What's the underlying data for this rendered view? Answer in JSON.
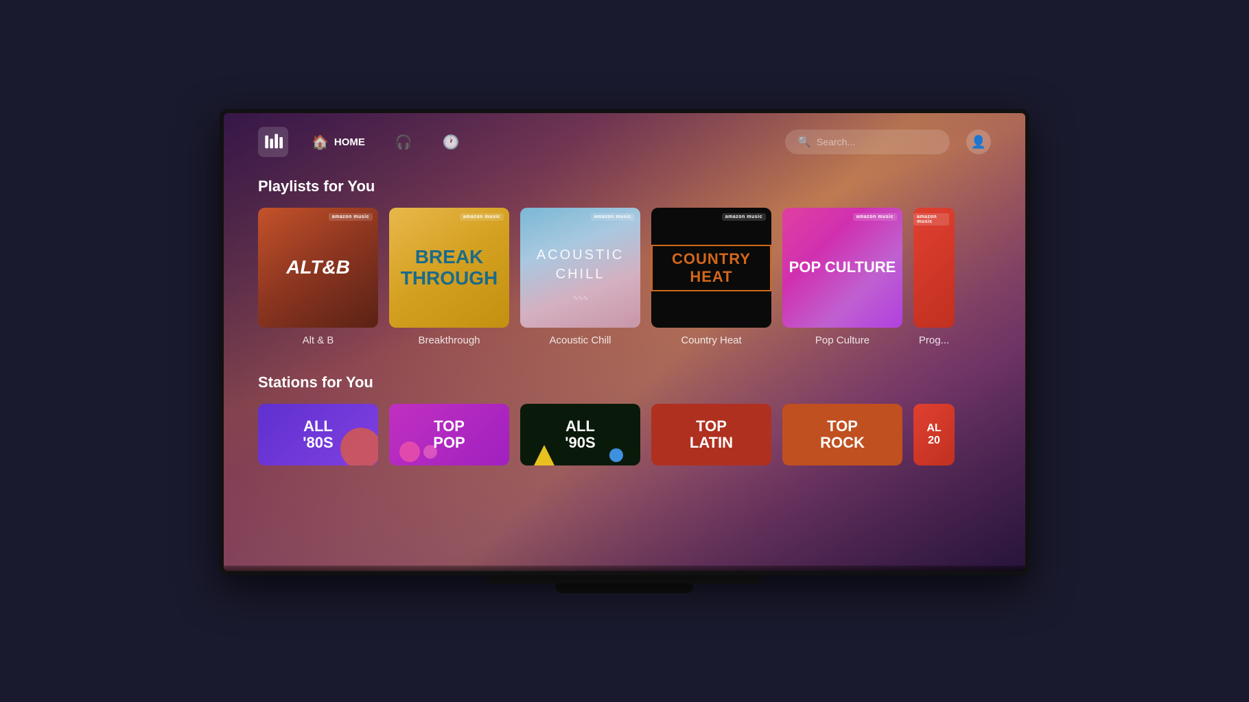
{
  "app": {
    "title": "Amazon Music"
  },
  "nav": {
    "logo_aria": "Amazon Music Logo",
    "items": [
      {
        "id": "home",
        "label": "HOME",
        "icon": "🏠",
        "active": true
      },
      {
        "id": "headphones",
        "label": "",
        "icon": "🎧",
        "active": false
      },
      {
        "id": "history",
        "label": "",
        "icon": "🕐",
        "active": false
      }
    ],
    "search_placeholder": "Search...",
    "user_icon": "👤"
  },
  "playlists_section": {
    "title": "Playlists for You",
    "cards": [
      {
        "id": "alt-b",
        "label": "Alt & B",
        "style": "altb",
        "badge": "amazon music"
      },
      {
        "id": "breakthrough",
        "label": "Breakthrough",
        "style": "breakthrough",
        "badge": "amazon music"
      },
      {
        "id": "acoustic-chill",
        "label": "Acoustic Chill",
        "style": "acoustic",
        "badge": "amazon music"
      },
      {
        "id": "country-heat",
        "label": "Country Heat",
        "style": "country",
        "badge": "amazon music"
      },
      {
        "id": "pop-culture",
        "label": "Pop Culture",
        "style": "popculture",
        "badge": "amazon music"
      },
      {
        "id": "partial",
        "label": "Prog...",
        "style": "partial",
        "badge": "amazon music"
      }
    ]
  },
  "stations_section": {
    "title": "Stations for You",
    "stations": [
      {
        "id": "all-80s",
        "line1": "ALL",
        "line2": "'80S",
        "style": "80s"
      },
      {
        "id": "top-pop",
        "line1": "TOP",
        "line2": "POP",
        "style": "toppop"
      },
      {
        "id": "all-90s",
        "line1": "ALL",
        "line2": "'90S",
        "style": "90s"
      },
      {
        "id": "top-latin",
        "line1": "TOP",
        "line2": "LATIN",
        "style": "toplatin"
      },
      {
        "id": "top-rock",
        "line1": "TOP",
        "line2": "ROCK",
        "style": "toprock"
      },
      {
        "id": "partial-station",
        "line1": "AL",
        "line2": "20",
        "style": "partial"
      }
    ]
  }
}
